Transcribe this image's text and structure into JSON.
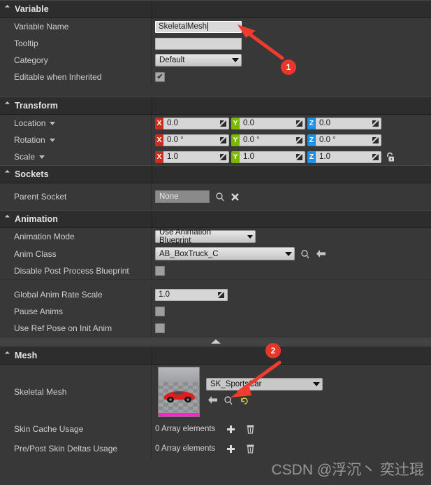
{
  "sections": {
    "variable": {
      "title": "Variable",
      "rows": {
        "variable_name": {
          "label": "Variable Name",
          "value": "SkeletalMesh"
        },
        "tooltip": {
          "label": "Tooltip",
          "value": ""
        },
        "category": {
          "label": "Category",
          "value": "Default"
        },
        "editable_when_inherited": {
          "label": "Editable when Inherited",
          "checked_mark": "✔"
        }
      }
    },
    "transform": {
      "title": "Transform",
      "rows": {
        "location": {
          "label": "Location",
          "x": "0.0",
          "y": "0.0",
          "z": "0.0"
        },
        "rotation": {
          "label": "Rotation",
          "x": "0.0 °",
          "y": "0.0 °",
          "z": "0.0 °"
        },
        "scale": {
          "label": "Scale",
          "x": "1.0",
          "y": "1.0",
          "z": "1.0"
        }
      },
      "axis_labels": {
        "x": "X",
        "y": "Y",
        "z": "Z"
      },
      "axis_colors": {
        "x": "#c8301c",
        "y": "#7ab800",
        "z": "#1e90e8"
      }
    },
    "sockets": {
      "title": "Sockets",
      "rows": {
        "parent_socket": {
          "label": "Parent Socket",
          "value": "None"
        }
      }
    },
    "animation": {
      "title": "Animation",
      "rows": {
        "animation_mode": {
          "label": "Animation Mode",
          "value": "Use Animation Blueprint"
        },
        "anim_class": {
          "label": "Anim Class",
          "value": "AB_BoxTruck_C"
        },
        "disable_post_process_blueprint": {
          "label": "Disable Post Process Blueprint"
        },
        "global_anim_rate_scale": {
          "label": "Global Anim Rate Scale",
          "value": "1.0"
        },
        "pause_anims": {
          "label": "Pause Anims"
        },
        "use_ref_pose_on_init_anim": {
          "label": "Use Ref Pose on Init Anim"
        }
      }
    },
    "mesh": {
      "title": "Mesh",
      "rows": {
        "skeletal_mesh": {
          "label": "Skeletal Mesh",
          "value": "SK_SportsCar"
        },
        "skin_cache_usage": {
          "label": "Skin Cache Usage",
          "value": "0 Array elements"
        },
        "pre_post_skin_deltas_usage": {
          "label": "Pre/Post Skin Deltas Usage",
          "value": "0 Array elements"
        }
      }
    }
  },
  "annotations": {
    "marker_one": "1",
    "marker_two": "2",
    "accent_color": "#e8362b"
  },
  "watermark": {
    "text": "CSDN @浮沉丶 奕辻琨"
  }
}
